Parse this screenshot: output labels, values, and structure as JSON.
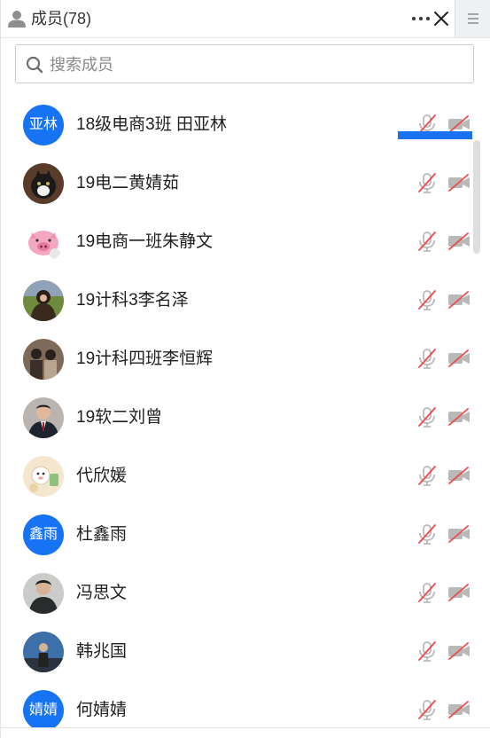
{
  "header": {
    "title": "成员(78)",
    "icons": {
      "person": "person-icon",
      "more": "more-horizontal-icon",
      "close": "close-icon",
      "menu": "hamburger-menu-icon"
    }
  },
  "search": {
    "placeholder": "搜索成员",
    "value": ""
  },
  "colors": {
    "accent": "#1673f3",
    "mute_red": "#ef4b4b",
    "icon_gray": "#b9b9b9"
  },
  "members": [
    {
      "name": "18级电商3班 田亚林",
      "avatar_text": "亚林",
      "avatar_type": "text",
      "mic": "muted",
      "camera": "off"
    },
    {
      "name": "19电二黄婧茹",
      "avatar_text": "",
      "avatar_type": "photo-cat",
      "mic": "muted",
      "camera": "off"
    },
    {
      "name": "19电商一班朱静文",
      "avatar_text": "",
      "avatar_type": "photo-pig",
      "mic": "muted",
      "camera": "off"
    },
    {
      "name": "19计科3李名泽",
      "avatar_text": "",
      "avatar_type": "photo-person",
      "mic": "muted",
      "camera": "off"
    },
    {
      "name": "19计科四班李恒辉",
      "avatar_text": "",
      "avatar_type": "photo-person",
      "mic": "muted",
      "camera": "off"
    },
    {
      "name": "19软二刘曾",
      "avatar_text": "",
      "avatar_type": "photo-person",
      "mic": "muted",
      "camera": "off"
    },
    {
      "name": "代欣媛",
      "avatar_text": "",
      "avatar_type": "photo-cartoon",
      "mic": "muted",
      "camera": "off"
    },
    {
      "name": "杜鑫雨",
      "avatar_text": "鑫雨",
      "avatar_type": "text",
      "mic": "muted",
      "camera": "off"
    },
    {
      "name": "冯思文",
      "avatar_text": "",
      "avatar_type": "photo-person",
      "mic": "muted",
      "camera": "off"
    },
    {
      "name": "韩兆国",
      "avatar_text": "",
      "avatar_type": "photo-person",
      "mic": "muted",
      "camera": "off"
    },
    {
      "name": "何婧婧",
      "avatar_text": "婧婧",
      "avatar_type": "text",
      "mic": "muted",
      "camera": "off"
    }
  ]
}
